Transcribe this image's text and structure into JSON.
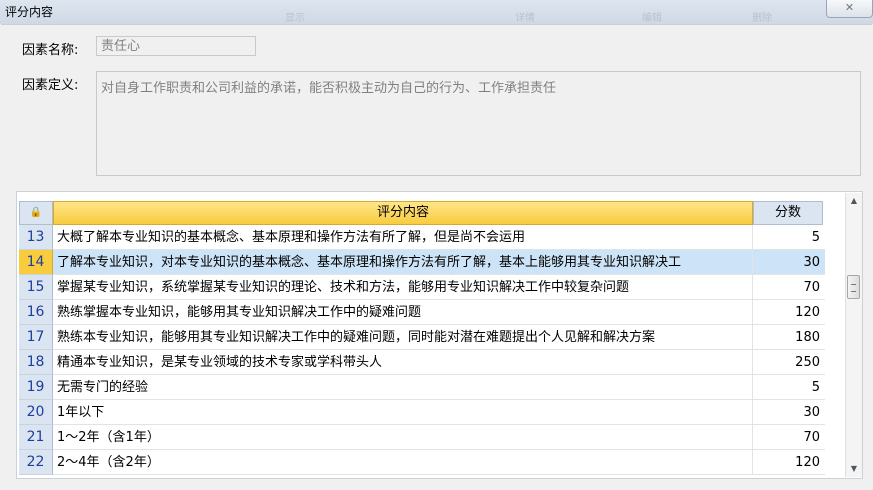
{
  "window": {
    "title": "评分内容",
    "close_symbol": "✕",
    "background_hints": [
      "显示",
      "详情",
      "编辑",
      "删除"
    ]
  },
  "form": {
    "name_label": "因素名称:",
    "name_value": "责任心",
    "definition_label": "因素定义:",
    "definition_value": "对自身工作职责和公司利益的承诺，能否积极主动为自己的行为、工作承担责任"
  },
  "grid": {
    "lock_icon": "lock-icon",
    "header_content": "评分内容",
    "header_score": "分数",
    "rows": [
      {
        "num": "13",
        "content": "大概了解本专业知识的基本概念、基本原理和操作方法有所了解，但是尚不会运用",
        "score": "5"
      },
      {
        "num": "14",
        "content": "了解本专业知识，对本专业知识的基本概念、基本原理和操作方法有所了解，基本上能够用其专业知识解决工",
        "score": "30"
      },
      {
        "num": "15",
        "content": "掌握某专业知识，系统掌握某专业知识的理论、技术和方法，能够用专业知识解决工作中较复杂问题",
        "score": "70"
      },
      {
        "num": "16",
        "content": "熟练掌握本专业知识，能够用其专业知识解决工作中的疑难问题",
        "score": "120"
      },
      {
        "num": "17",
        "content": "熟练本专业知识，能够用其专业知识解决工作中的疑难问题，同时能对潜在难题提出个人见解和解决方案",
        "score": "180"
      },
      {
        "num": "18",
        "content": "精通本专业知识，是某专业领域的技术专家或学科带头人",
        "score": "250"
      },
      {
        "num": "19",
        "content": "无需专门的经验",
        "score": "5"
      },
      {
        "num": "20",
        "content": "1年以下",
        "score": "30"
      },
      {
        "num": "21",
        "content": "1～2年（含1年）",
        "score": "70"
      },
      {
        "num": "22",
        "content": "2～4年（含2年）",
        "score": "120"
      }
    ]
  },
  "colors": {
    "header_accent": "#f8cc3d",
    "selected_row": "#cde3f7",
    "row_number": "#1f3f9e"
  }
}
